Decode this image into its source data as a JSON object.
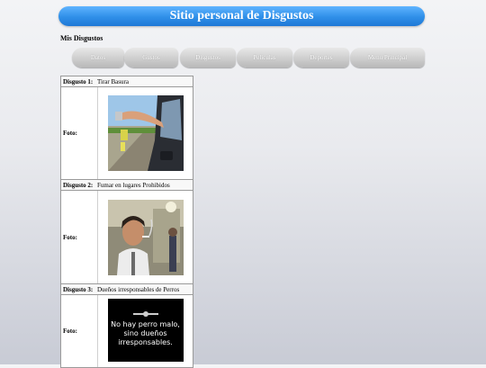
{
  "site": {
    "title": "Sitio personal de Disgustos",
    "subtitle": "Mis Disgustos"
  },
  "nav": {
    "items": [
      "Datos",
      "Gustos",
      "Disgustos",
      "Peliculas",
      "Deportes",
      "Menu Principal"
    ]
  },
  "table": {
    "photo_label": "Foto:",
    "rows": [
      {
        "label": "Disgusto 1:",
        "value": "Tirar Basura",
        "image": "littering-from-car-photo"
      },
      {
        "label": "Disgusto 2:",
        "value": "Fumar en lugares Prohibidos",
        "image": "smoking-man-photo"
      },
      {
        "label": "Disgusto 3:",
        "value": "Dueños irresponsables de Perros",
        "image": "dog-owner-poster"
      }
    ]
  },
  "poster_text": [
    "No hay perro malo,",
    "sino dueños",
    "irresponsables."
  ]
}
